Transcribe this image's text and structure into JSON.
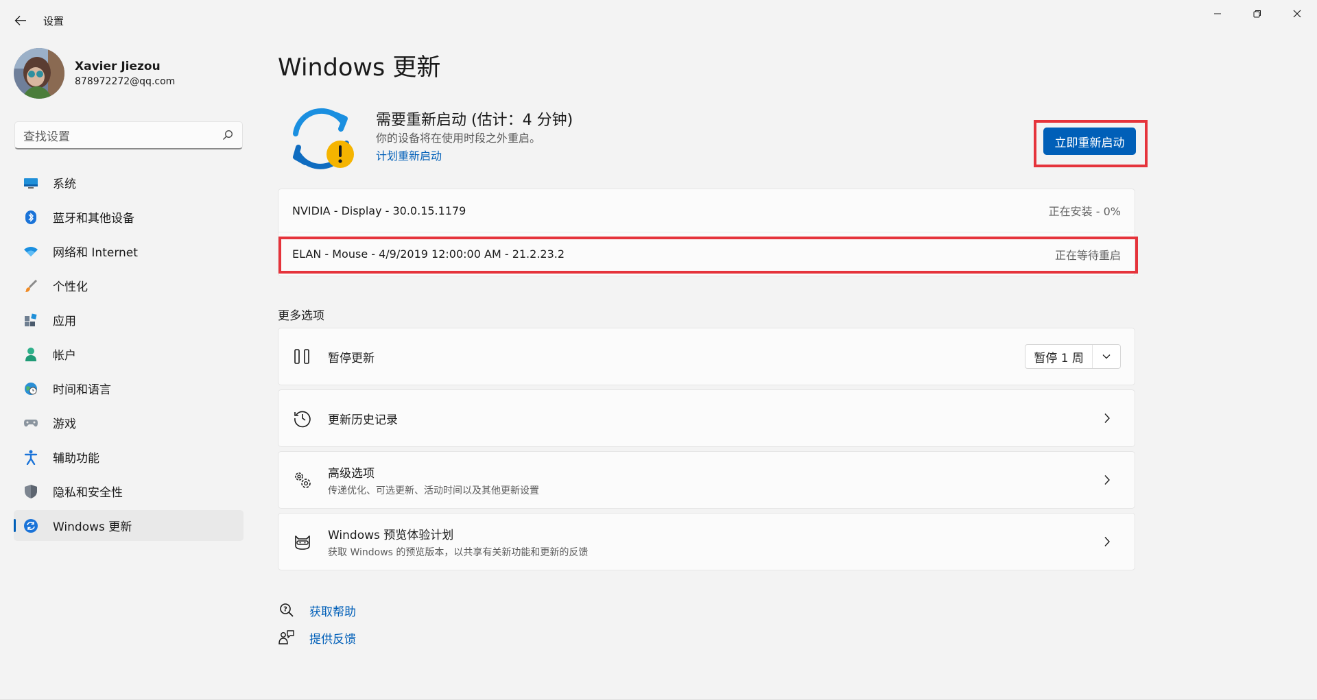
{
  "app": {
    "title": "设置"
  },
  "profile": {
    "name": "Xavier Jiezou",
    "email": "878972272@qq.com"
  },
  "search": {
    "placeholder": "查找设置"
  },
  "nav": {
    "items": [
      {
        "label": "系统",
        "icon": "monitor-icon"
      },
      {
        "label": "蓝牙和其他设备",
        "icon": "bluetooth-icon"
      },
      {
        "label": "网络和 Internet",
        "icon": "wifi-icon"
      },
      {
        "label": "个性化",
        "icon": "brush-icon"
      },
      {
        "label": "应用",
        "icon": "apps-icon"
      },
      {
        "label": "帐户",
        "icon": "person-icon"
      },
      {
        "label": "时间和语言",
        "icon": "globe-clock-icon"
      },
      {
        "label": "游戏",
        "icon": "gamepad-icon"
      },
      {
        "label": "辅助功能",
        "icon": "accessibility-icon"
      },
      {
        "label": "隐私和安全性",
        "icon": "shield-icon"
      },
      {
        "label": "Windows 更新",
        "icon": "update-icon",
        "active": true
      }
    ]
  },
  "page": {
    "title": "Windows 更新"
  },
  "status": {
    "title": "需要重新启动 (估计：4 分钟)",
    "subtitle": "你的设备将在使用时段之外重启。",
    "schedule_link": "计划重新启动",
    "restart_button": "立即重新启动"
  },
  "updates": [
    {
      "name": "NVIDIA - Display - 30.0.15.1179",
      "status": "正在安装 - 0%"
    },
    {
      "name": "ELAN - Mouse - 4/9/2019 12:00:00 AM - 21.2.23.2",
      "status": "正在等待重启"
    }
  ],
  "more_options": {
    "title": "更多选项",
    "pause": {
      "label": "暂停更新",
      "value": "暂停 1 周"
    },
    "history": {
      "label": "更新历史记录"
    },
    "advanced": {
      "label": "高级选项",
      "description": "传递优化、可选更新、活动时间以及其他更新设置"
    },
    "insider": {
      "label": "Windows 预览体验计划",
      "description": "获取 Windows 的预览版本，以共享有关新功能和更新的反馈"
    }
  },
  "help": {
    "get_help": "获取帮助",
    "feedback": "提供反馈"
  },
  "colors": {
    "accent": "#005fb8",
    "highlight": "#e5333b",
    "background": "#f3f3f3"
  }
}
